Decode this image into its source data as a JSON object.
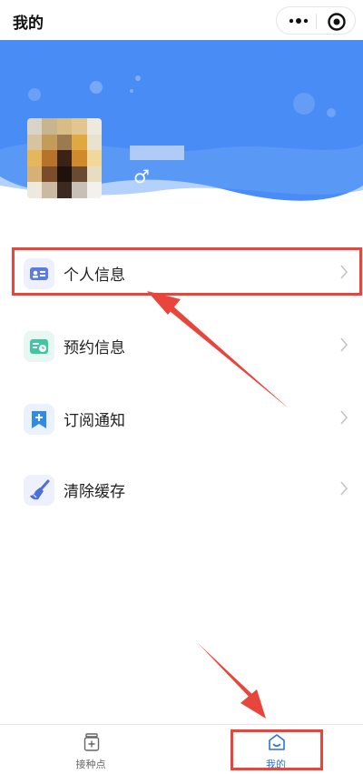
{
  "app": {
    "title": "我的"
  },
  "capsule": {
    "more_icon": "more-dots-icon",
    "close_icon": "target-circle-icon"
  },
  "profile": {
    "gender_symbol": "♂",
    "header_color": "#4a8cf5"
  },
  "menu": {
    "items": [
      {
        "label": "个人信息",
        "icon": "id-card-icon",
        "icon_bg": "#eef1fb",
        "icon_color": "#4c6fd8"
      },
      {
        "label": "预约信息",
        "icon": "appointment-icon",
        "icon_bg": "#e8f7f2",
        "icon_color": "#39c49a"
      },
      {
        "label": "订阅通知",
        "icon": "bookmark-plus-icon",
        "icon_bg": "#eaf3fd",
        "icon_color": "#2f8be6"
      },
      {
        "label": "清除缓存",
        "icon": "brush-icon",
        "icon_bg": "#eef1fb",
        "icon_color": "#4c6fd8"
      }
    ]
  },
  "tabbar": {
    "tabs": [
      {
        "label": "接种点",
        "icon": "vaccine-bottle-icon",
        "color": "#666666"
      },
      {
        "label": "我的",
        "icon": "home-smile-icon",
        "color": "#2f6fe0"
      }
    ]
  },
  "annotation_color": "#e8453c"
}
